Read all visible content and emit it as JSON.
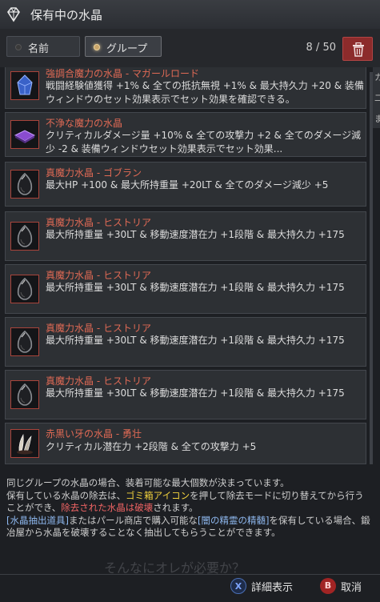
{
  "header": {
    "title": "保有中の水晶",
    "icon": "crystal-icon"
  },
  "toolbar": {
    "tab_name": "名前",
    "tab_group": "グループ",
    "count": "8 / 50"
  },
  "side_panel": {
    "chars": [
      "カ",
      "二",
      "ま"
    ]
  },
  "items": [
    {
      "name": "強調合魔力の水晶 - マガールロード",
      "desc": "戦闘経験値獲得 +1% & 全ての抵抗無視 +1% & 最大持久力 +20 & 装備ウィンドウのセット効果表示でセット効果を確認できる。",
      "icon": "blue-crystal-icon",
      "color": "#3a62c8"
    },
    {
      "name": "不浄な魔力の水晶",
      "desc": "クリティカルダメージ量 +10% & 全ての攻撃力 +2 & 全てのダメージ減少 -2 & 装備ウィンドウセット効果表示でセット効果...",
      "icon": "purple-crystal-icon",
      "color": "#8a4ccf"
    },
    {
      "name": "真魔力水晶 - ゴブラン",
      "desc": "最大HP +100 & 最大所持重量 +20LT & 全てのダメージ減少 +5",
      "icon": "dark-crystal-icon",
      "color": "#8a8d92"
    },
    {
      "name": "真魔力水晶 - ヒストリア",
      "desc": "最大所持重量 +30LT & 移動速度潜在力 +1段階 & 最大持久力 +175",
      "icon": "dark-crystal-icon",
      "color": "#8a8d92"
    },
    {
      "name": "真魔力水晶 - ヒストリア",
      "desc": "最大所持重量 +30LT & 移動速度潜在力 +1段階 & 最大持久力 +175",
      "icon": "dark-crystal-icon",
      "color": "#8a8d92"
    },
    {
      "name": "真魔力水晶 - ヒストリア",
      "desc": "最大所持重量 +30LT & 移動速度潜在力 +1段階 & 最大持久力 +175",
      "icon": "dark-crystal-icon",
      "color": "#8a8d92"
    },
    {
      "name": "真魔力水晶 - ヒストリア",
      "desc": "最大所持重量 +30LT & 移動速度潜在力 +1段階 & 最大持久力 +175",
      "icon": "dark-crystal-icon",
      "color": "#8a8d92"
    },
    {
      "name": "赤黒い牙の水晶 - 勇壮",
      "desc": "クリティカル潜在力 +2段階 & 全ての攻撃力 +5",
      "icon": "fang-crystal-icon",
      "color": "#d8d2c4"
    }
  ],
  "info": {
    "line1": "同じグループの水晶の場合、装着可能な最大個数が決まっています。",
    "line2a": "保有している水晶の除去は、",
    "line2b": "ゴミ箱アイコン",
    "line2c": "を押して除去モードに切り替えてから行うことができ、",
    "line2d": "除去された水晶は破壊",
    "line2e": "されます。",
    "line3a": "[水晶抽出道具]",
    "line3b": "またはパール商店で購入可能な",
    "line3c": "[闇の精霊の精髄]",
    "line3d": "を保有している場合、鍛冶屋から水晶を破壊することなく抽出してもらうことができます。",
    "ghost": "そんなにオレが必要か？"
  },
  "footer": {
    "details_key": "X",
    "details_label": "詳細表示",
    "cancel_key": "B",
    "cancel_label": "取消"
  }
}
